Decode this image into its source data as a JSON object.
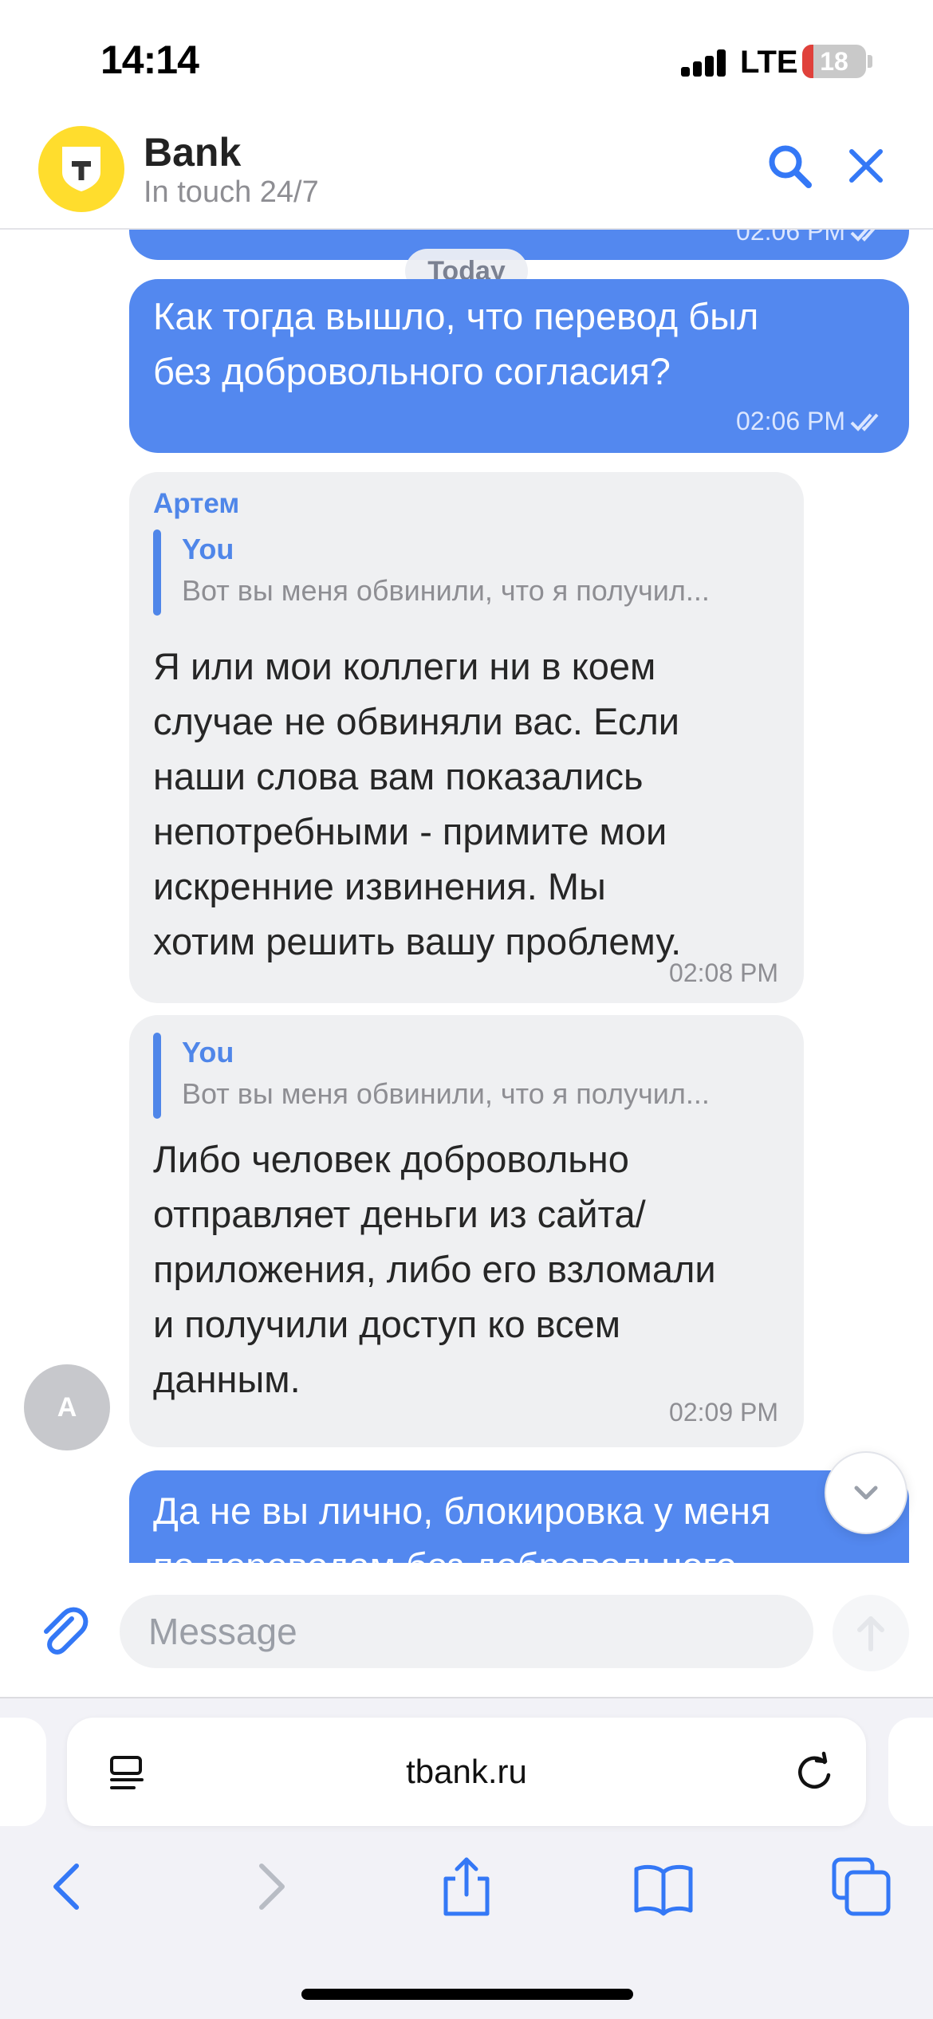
{
  "status_bar": {
    "time": "14:14",
    "network": "LTE",
    "battery": "18",
    "battery_level": 0.18
  },
  "header": {
    "title": "Bank",
    "subtitle": "In touch 24/7"
  },
  "chat": {
    "date_separator": "Today",
    "messages": [
      {
        "direction": "out",
        "time": "02:06 PM"
      },
      {
        "direction": "out",
        "lines": [
          "Как тогда вышло, что перевод был",
          "без добровольного согласия?"
        ],
        "time": "02:06 PM"
      },
      {
        "direction": "in",
        "sender": "Артем",
        "reply_author": "You",
        "reply_text": "Вот вы меня обвинили, что я получил...",
        "lines": [
          "Я или мои коллеги  ни в коем",
          "случае не обвиняли вас. Если",
          "наши слова вам показались",
          "непотребными - примите мои",
          "искренние извинения. Мы",
          "хотим решить вашу проблему."
        ],
        "time": "02:08 PM"
      },
      {
        "direction": "in",
        "reply_author": "You",
        "reply_text": "Вот вы меня обвинили, что я получил...",
        "lines": [
          "Либо человек добровольно",
          "отправляет деньги из сайта/",
          "приложения, либо его взломали",
          "и получили доступ ко всем",
          "данным."
        ],
        "time": "02:09 PM"
      },
      {
        "direction": "out",
        "lines": [
          "Да не вы лично, блокировка у меня",
          "по переводам без добровольного"
        ]
      }
    ],
    "agent_avatar_initial": "A"
  },
  "composer": {
    "placeholder": "Message"
  },
  "browser": {
    "url": "tbank.ru"
  },
  "colors": {
    "outgoing_bubble": "#5388ef",
    "incoming_bubble": "#eff0f2",
    "accent": "#4f86e9",
    "brand_yellow": "#ffdd2d",
    "ios_blue": "#3478f6"
  },
  "icons": {
    "header": [
      "bank-logo-icon",
      "search-icon",
      "close-icon"
    ],
    "composer": [
      "paperclip-icon",
      "send-arrow-icon"
    ],
    "browser": [
      "reader-icon",
      "reload-icon",
      "back-icon",
      "forward-icon",
      "share-icon",
      "bookmarks-icon",
      "tabs-icon"
    ]
  }
}
